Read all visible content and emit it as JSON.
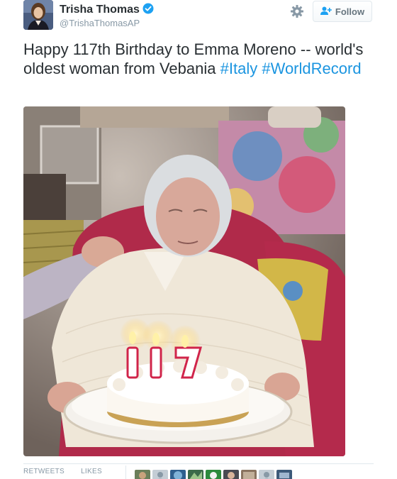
{
  "user": {
    "name": "Trisha Thomas",
    "handle": "@TrishaThomasAP"
  },
  "actions": {
    "follow_label": "Follow"
  },
  "tweet": {
    "text_plain": "Happy 117th Birthday to Emma Moreno -- world's oldest woman from Vebania",
    "hashtag_1": "#Italy",
    "hashtag_2": "#WorldRecord"
  },
  "stats": {
    "retweets_label": "RETWEETS",
    "likes_label": "LIKES"
  },
  "icons": {
    "verified": "verified-badge-icon",
    "settings": "gear-icon",
    "follow": "add-user-icon"
  },
  "colors": {
    "link": "#1b95e0",
    "verified": "#1da1f2",
    "text": "#292f33",
    "muted": "#8899a6"
  }
}
